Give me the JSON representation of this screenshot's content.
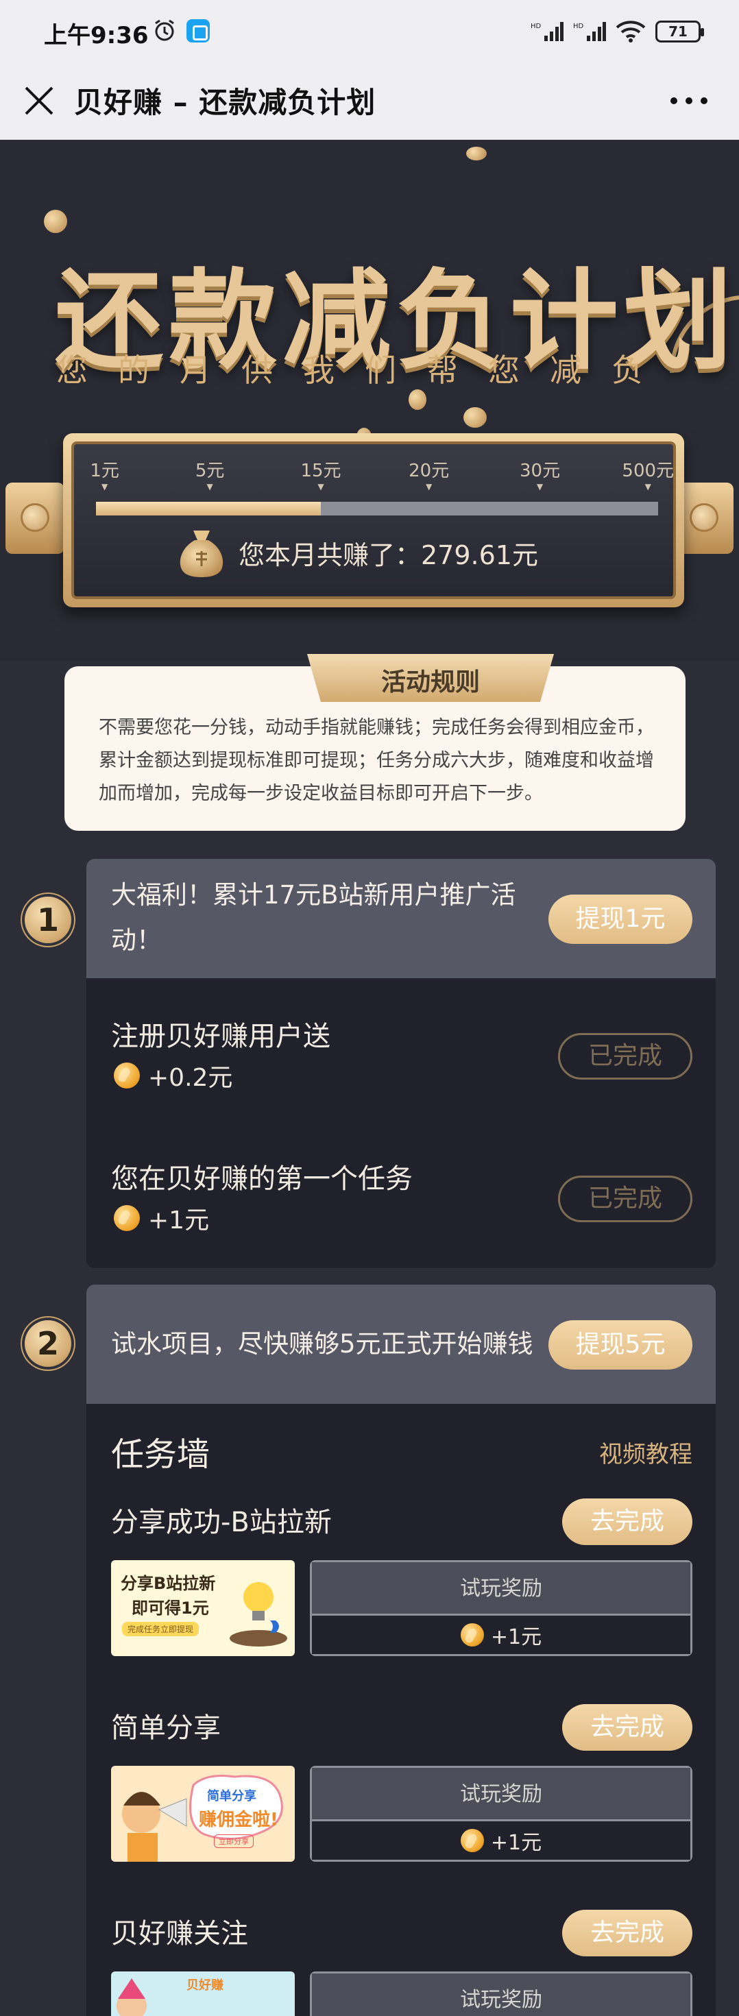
{
  "status_bar": {
    "time": "上午9:36",
    "battery": "71",
    "signal1": "HD",
    "signal2": "HD"
  },
  "nav": {
    "title": "贝好赚 – 还款减负计划"
  },
  "hero": {
    "title": "还款减负计划",
    "subtitle": "您的月供我们帮您减负",
    "ticks": [
      "1元",
      "5元",
      "15元",
      "20元",
      "30元",
      "500元"
    ],
    "progress_fraction": 0.4,
    "earned_text": "您本月共赚了：279.61元"
  },
  "rules": {
    "title": "活动规则",
    "text": "不需要您花一分钱，动动手指就能赚钱；完成任务会得到相应金币，累计金额达到提现标准即可提现；任务分成六大步，随难度和收益增加而增加，完成每一步设定收益目标即可开启下一步。"
  },
  "step1": {
    "number": "1",
    "headline": "大福利！累计17元B站新用户推广活动！",
    "withdraw_label": "提现1元",
    "tasks": [
      {
        "name": "注册贝好赚用户送",
        "reward": "+0.2元",
        "status": "已完成"
      },
      {
        "name": "您在贝好赚的第一个任务",
        "reward": "+1元",
        "status": "已完成"
      }
    ]
  },
  "step2": {
    "number": "2",
    "headline": "试水项目，尽快赚够5元正式开始赚钱",
    "withdraw_label": "提现5元",
    "wall_title": "任务墙",
    "video_link": "视频教程",
    "tasks": [
      {
        "name": "分享成功-B站拉新",
        "action": "去完成",
        "reward_title": "试玩奖励",
        "reward": "+1元",
        "thumb_line1": "分享B站拉新",
        "thumb_line2": "即可得1元",
        "thumb_note": "完成任务立即提现"
      },
      {
        "name": "简单分享",
        "action": "去完成",
        "reward_title": "试玩奖励",
        "reward": "+1元",
        "thumb_line1": "简单分享",
        "thumb_line2": "赚佣金啦!",
        "thumb_note": "立即分享"
      },
      {
        "name": "贝好赚关注",
        "action": "去完成",
        "reward_title": "试玩奖励",
        "thumb_line1": "贝好赚"
      }
    ]
  },
  "colors": {
    "gold": "#e2bd86",
    "bg_dark": "#2c2d37",
    "card": "#20212a",
    "card_head": "#575866"
  }
}
